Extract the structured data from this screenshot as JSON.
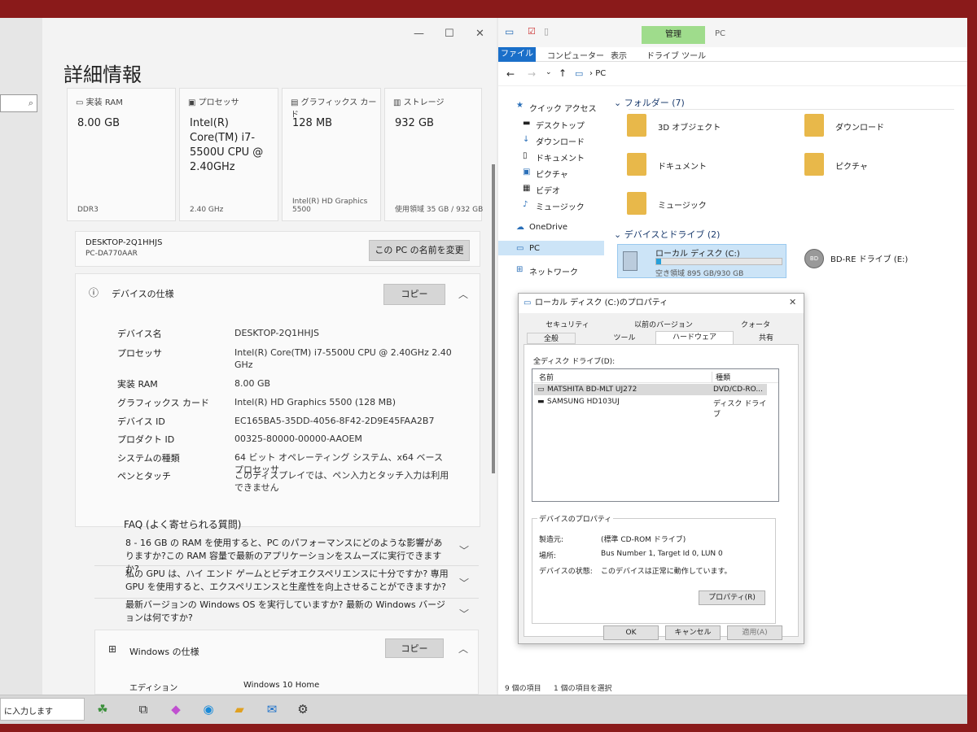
{
  "settings": {
    "title": "詳細情報",
    "window_buttons": [
      "—",
      "☐",
      "✕"
    ],
    "cards": [
      {
        "header": "実装 RAM",
        "value": "8.00 GB",
        "sub": "DDR3"
      },
      {
        "header": "プロセッサ",
        "value": "Intel(R) Core(TM) i7-5500U CPU @ 2.40GHz",
        "sub": "2.40 GHz"
      },
      {
        "header": "グラフィックス カード",
        "value": "128 MB",
        "sub": "Intel(R) HD Graphics 5500"
      },
      {
        "header": "ストレージ",
        "value": "932 GB",
        "sub": "使用領域 35 GB / 932 GB"
      }
    ],
    "device_name": "DESKTOP-2Q1HHJS",
    "device_model": "PC-DA770AAR",
    "rename_button": "この PC の名前を変更",
    "device_spec_title": "デバイスの仕様",
    "copy_button": "コピー",
    "specs": [
      {
        "label": "デバイス名",
        "value": "DESKTOP-2Q1HHJS"
      },
      {
        "label": "プロセッサ",
        "value": "Intel(R) Core(TM) i7-5500U CPU @ 2.40GHz 2.40 GHz"
      },
      {
        "label": "実装 RAM",
        "value": "8.00 GB"
      },
      {
        "label": "グラフィックス カード",
        "value": "Intel(R) HD Graphics 5500 (128 MB)"
      },
      {
        "label": "デバイス ID",
        "value": "EC165BA5-35DD-4056-8F42-2D9E45FAA2B7"
      },
      {
        "label": "プロダクト ID",
        "value": "00325-80000-00000-AAOEM"
      },
      {
        "label": "システムの種類",
        "value": "64 ビット オペレーティング システム、x64 ベース プロセッサ"
      },
      {
        "label": "ペンとタッチ",
        "value": "このディスプレイでは、ペン入力とタッチ入力は利用できません"
      }
    ],
    "faq_title": "FAQ (よく寄せられる質問)",
    "faq": [
      "8 - 16 GB の RAM を使用すると、PC のパフォーマンスにどのような影響がありますか?この RAM 容量で最新のアプリケーションをスムーズに実行できますか?",
      "私の GPU は、ハイ エンド ゲームとビデオエクスペリエンスに十分ですか? 専用 GPU を使用すると、エクスペリエンスと生産性を向上させることができますか?",
      "最新バージョンの Windows OS を実行していますか? 最新の Windows バージョンは何ですか?"
    ],
    "windows_spec_title": "Windows の仕様",
    "edition_label": "エディション",
    "edition_value": "Windows 10 Home"
  },
  "explorer": {
    "manage_tab": "管理",
    "title": "PC",
    "ribbon_tabs": [
      "ファイル",
      "コンピューター",
      "表示",
      "ドライブ ツール"
    ],
    "address": "PC",
    "nav": [
      "クイック アクセス",
      "デスクトップ",
      "ダウンロード",
      "ドキュメント",
      "ピクチャ",
      "ビデオ",
      "ミュージック",
      "OneDrive",
      "PC",
      "ネットワーク"
    ],
    "folders_header": "フォルダー (7)",
    "folders": [
      "3D オブジェクト",
      "ダウンロード",
      "ドキュメント",
      "ピクチャ",
      "ミュージック"
    ],
    "drives_header": "デバイスとドライブ (2)",
    "local_disk_name": "ローカル ディスク (C:)",
    "local_disk_free": "空き領域 895 GB/930 GB",
    "local_disk_used_fraction": 0.04,
    "bd_drive_name": "BD-RE ドライブ (E:)",
    "bd_badge": "BD",
    "status_items": "9 個の項目",
    "status_selected": "1 個の項目を選択"
  },
  "dialog": {
    "title": "ローカル ディスク (C:)のプロパティ",
    "tabs_row1": [
      "セキュリティ",
      "以前のバージョン",
      "クォータ"
    ],
    "tabs_row2": [
      "全般",
      "ツール",
      "ハードウェア",
      "共有"
    ],
    "all_drives_label": "全ディスク ドライブ(D):",
    "col_name": "名前",
    "col_type": "種類",
    "drives": [
      {
        "name": "MATSHITA BD-MLT UJ272",
        "type": "DVD/CD-RO..."
      },
      {
        "name": "SAMSUNG HD103UJ",
        "type": "ディスク ドライブ"
      }
    ],
    "props_group": "デバイスのプロパティ",
    "maker_label": "製造元:",
    "maker_value": "(標準 CD-ROM ドライブ)",
    "location_label": "場所:",
    "location_value": "Bus Number 1, Target Id 0, LUN 0",
    "status_label": "デバイスの状態:",
    "status_value": "このデバイスは正常に動作しています。",
    "props_button": "プロパティ(R)",
    "ok": "OK",
    "cancel": "キャンセル",
    "apply": "適用(A)"
  },
  "taskbar": {
    "search_text": "に入力します"
  }
}
